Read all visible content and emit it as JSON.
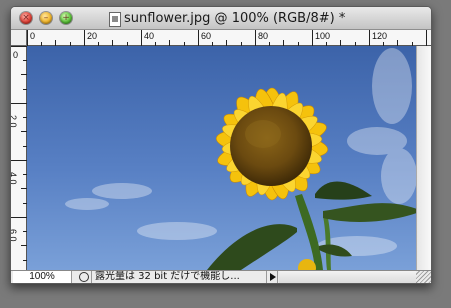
{
  "window": {
    "title": "sunflower.jpg @ 100% (RGB/8#) *"
  },
  "traffic_lights": {
    "close_glyph": "×",
    "minimize_glyph": "–",
    "maximize_glyph": "+"
  },
  "rulers": {
    "top_labels": [
      "0",
      "20",
      "40",
      "60",
      "80",
      "100",
      "120"
    ],
    "left_labels": [
      "0",
      "2 0",
      "4 0",
      "6 0"
    ]
  },
  "canvas": {
    "image_name": "sunflower.jpg",
    "sky_color": "#4a72b8",
    "petal_color": "#f5c20c",
    "center_color": "#6b4a10",
    "leaf_color": "#2e4a1c"
  },
  "status_bar": {
    "zoom": "100%",
    "message": "露光量は 32 bit だけで機能し...",
    "icon": "status-info-icon"
  }
}
